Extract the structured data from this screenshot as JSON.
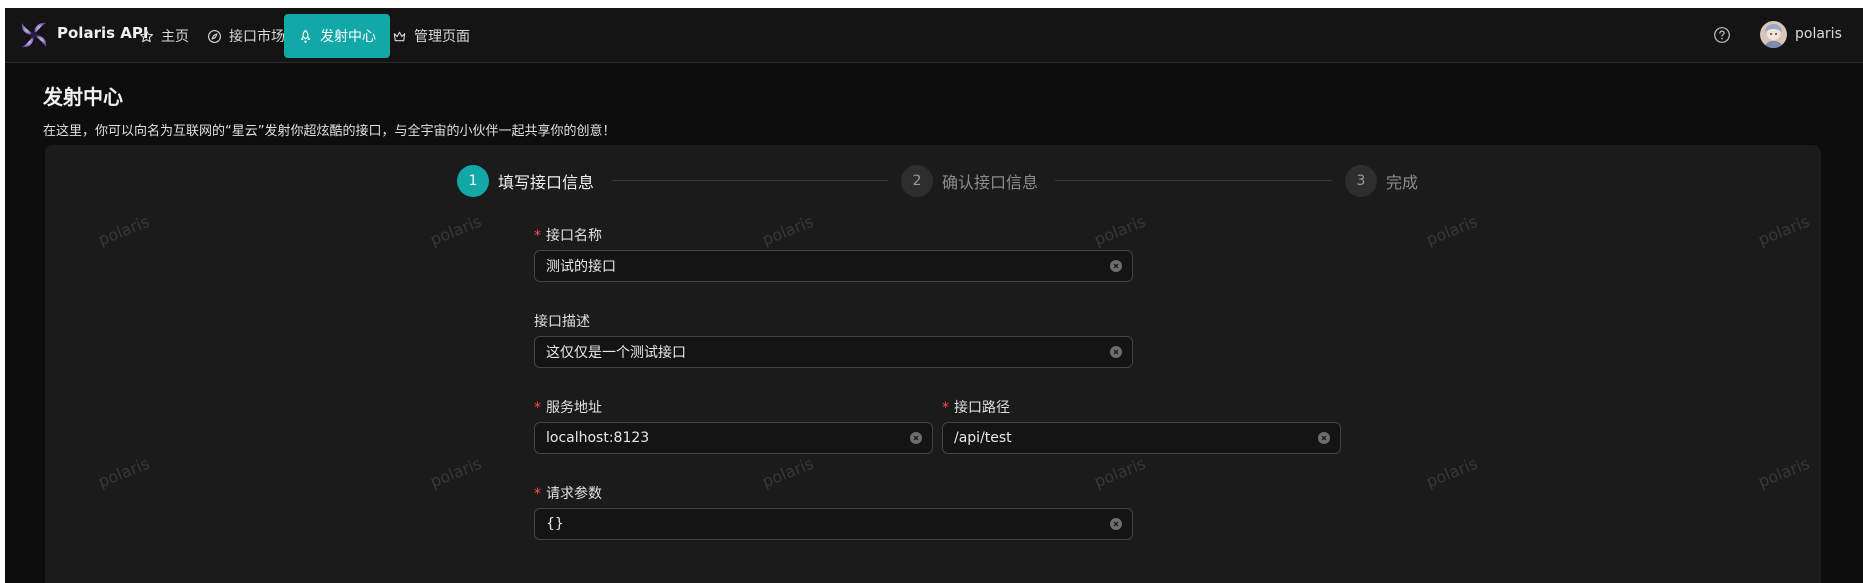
{
  "app": {
    "name": "Polaris API"
  },
  "nav": [
    {
      "label": "主页",
      "icon": "star-icon"
    },
    {
      "label": "接口市场",
      "icon": "compass-icon"
    },
    {
      "label": "发射中心",
      "icon": "rocket-icon",
      "active": true
    },
    {
      "label": "管理页面",
      "icon": "crown-icon"
    }
  ],
  "user": {
    "name": "polaris"
  },
  "page": {
    "title": "发射中心",
    "description": "在这里，你可以向名为互联网的“星云”发射你超炫酷的接口，与全宇宙的小伙伴一起共享你的创意！"
  },
  "watermark": "polaris",
  "steps": [
    {
      "number": "1",
      "title": "填写接口信息",
      "status": "active"
    },
    {
      "number": "2",
      "title": "确认接口信息",
      "status": "wait"
    },
    {
      "number": "3",
      "title": "完成",
      "status": "wait"
    }
  ],
  "form": {
    "name": {
      "label": "接口名称",
      "value": "测试的接口",
      "required": true
    },
    "description": {
      "label": "接口描述",
      "value": "这仅仅是一个测试接口",
      "required": false
    },
    "host": {
      "label": "服务地址",
      "value": "localhost:8123",
      "required": true
    },
    "path": {
      "label": "接口路径",
      "value": "/api/test",
      "required": true
    },
    "params": {
      "label": "请求参数",
      "value": "{}",
      "required": true
    }
  },
  "colors": {
    "accent": "#13a8a8",
    "background": "#0d0d0d",
    "card": "#1b1b1b",
    "required": "#ff4d4f"
  }
}
